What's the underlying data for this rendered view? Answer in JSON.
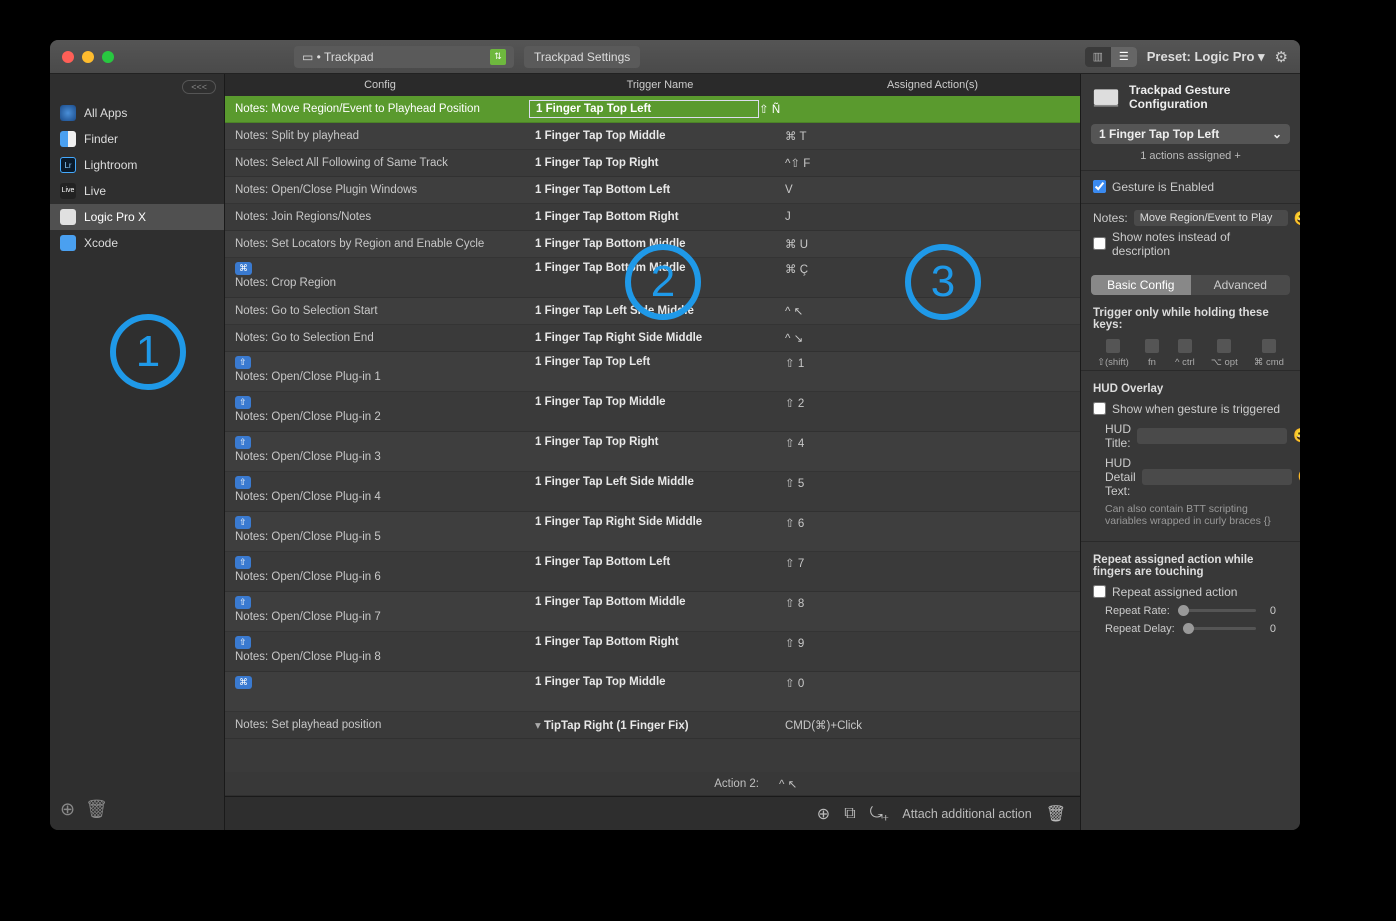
{
  "titlebar": {
    "device_label": "• Trackpad",
    "settings_btn": "Trackpad Settings",
    "preset_label": "Preset: Logic Pro ▾"
  },
  "sidebar": {
    "back": "<<<",
    "items": [
      {
        "label": "All Apps"
      },
      {
        "label": "Finder"
      },
      {
        "label": "Lightroom"
      },
      {
        "label": "Live"
      },
      {
        "label": "Logic Pro X"
      },
      {
        "label": "Xcode"
      }
    ]
  },
  "headers": {
    "config": "Config",
    "trigger": "Trigger Name",
    "action": "Assigned Action(s)"
  },
  "rows": [
    {
      "config": "Notes: Move Region/Event to Playhead Position",
      "trigger": "1 Finger Tap Top Left",
      "action": "⇧ Ñ",
      "sel": true
    },
    {
      "config": "Notes: Split by playhead",
      "trigger": "1 Finger Tap Top Middle",
      "action": "⌘ T"
    },
    {
      "config": "Notes: Select All Following of Same Track",
      "trigger": "1 Finger Tap Top Right",
      "action": "^⇧ F"
    },
    {
      "config": "Notes: Open/Close Plugin Windows",
      "trigger": "1 Finger Tap Bottom Left",
      "action": "V"
    },
    {
      "config": "Notes: Join Regions/Notes",
      "trigger": "1 Finger Tap Bottom Right",
      "action": "J"
    },
    {
      "config": "Notes: Set Locators by Region and Enable Cycle",
      "trigger": "1 Finger Tap Bottom Middle",
      "action": "⌘ U"
    },
    {
      "config": "Notes: Crop Region",
      "trigger": "1 Finger Tap Bottom Middle",
      "action": "⌘ Ç",
      "badge": "⌘"
    },
    {
      "config": "Notes: Go to Selection Start",
      "trigger": "1 Finger Tap Left Side Middle",
      "action": "^ ↖"
    },
    {
      "config": "Notes: Go to Selection End",
      "trigger": "1 Finger Tap Right Side Middle",
      "action": "^ ↘"
    },
    {
      "config": "Notes: Open/Close Plug-in 1",
      "trigger": "1 Finger Tap Top Left",
      "action": "⇧ 1",
      "badge": "⇧"
    },
    {
      "config": "Notes: Open/Close Plug-in 2",
      "trigger": "1 Finger Tap Top Middle",
      "action": "⇧ 2",
      "badge": "⇧"
    },
    {
      "config": "Notes: Open/Close Plug-in 3",
      "trigger": "1 Finger Tap Top Right",
      "action": "⇧ 4",
      "badge": "⇧"
    },
    {
      "config": "Notes: Open/Close Plug-in 4",
      "trigger": "1 Finger Tap Left Side Middle",
      "action": "⇧ 5",
      "badge": "⇧"
    },
    {
      "config": "Notes: Open/Close Plug-in 5",
      "trigger": "1 Finger Tap Right Side Middle",
      "action": "⇧ 6",
      "badge": "⇧"
    },
    {
      "config": "Notes: Open/Close Plug-in 6",
      "trigger": "1 Finger Tap Bottom Left",
      "action": "⇧ 7",
      "badge": "⇧"
    },
    {
      "config": "Notes: Open/Close Plug-in 7",
      "trigger": "1 Finger Tap Bottom Middle",
      "action": "⇧ 8",
      "badge": "⇧"
    },
    {
      "config": "Notes: Open/Close Plug-in 8",
      "trigger": "1 Finger Tap Bottom Right",
      "action": "⇧ 9",
      "badge": "⇧"
    },
    {
      "config": "",
      "trigger": "1 Finger Tap Top Middle",
      "action": "⇧ 0",
      "badge": "⌘"
    },
    {
      "config": "Notes: Set playhead position",
      "trigger": "TipTap Right (1 Finger Fix)",
      "action": "CMD(⌘)+Click",
      "disc": "▾"
    }
  ],
  "subrow": {
    "label": "Action 2:",
    "value": "^ ↖"
  },
  "footer": {
    "attach": "Attach additional action"
  },
  "inspector": {
    "title": "Trackpad Gesture Configuration",
    "gesture": "1 Finger Tap Top Left",
    "actions_assigned": "1 actions assigned +",
    "enabled_label": "Gesture is Enabled",
    "notes_label": "Notes:",
    "notes_value": "Move Region/Event to Play",
    "show_notes": "Show notes instead of description",
    "tab_basic": "Basic Config",
    "tab_adv": "Advanced",
    "trigger_only": "Trigger only while holding these keys:",
    "mods": [
      "⇧(shift)",
      "fn",
      "^ ctrl",
      "⌥ opt",
      "⌘ cmd"
    ],
    "hud_title": "HUD Overlay",
    "hud_show": "Show when gesture is triggered",
    "hud_t": "HUD Title:",
    "hud_d": "HUD Detail Text:",
    "hud_help": "Can also contain BTT scripting variables wrapped in curly braces {}",
    "repeat_title": "Repeat assigned action while fingers are touching",
    "repeat_ck": "Repeat assigned action",
    "repeat_rate": "Repeat Rate:",
    "repeat_delay": "Repeat Delay:",
    "zero": "0"
  }
}
